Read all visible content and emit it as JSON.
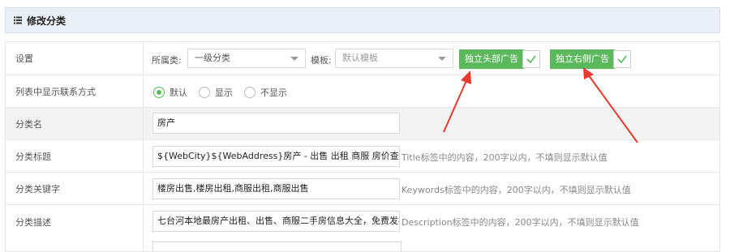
{
  "header": {
    "title": "修改分类",
    "icon": "list-icon"
  },
  "rows": {
    "settings": {
      "label": "设置",
      "category_label": "所属类:",
      "category_value": "一级分类",
      "template_label": "模板:",
      "template_value": "默认模板",
      "head_ad_label": "独立头部广告",
      "side_ad_label": "独立右侧广告"
    },
    "contact": {
      "label": "列表中显示联系方式",
      "options": [
        "默认",
        "显示",
        "不显示"
      ],
      "selected": "默认"
    },
    "name": {
      "label": "分类名",
      "value": "房产"
    },
    "title": {
      "label": "分类标题",
      "value": "${WebCity}${WebAddress}房产 - 出售 出租 商服 房价查询",
      "hint": "Title标签中的内容，200字以内，不填则显示默认值"
    },
    "keywords": {
      "label": "分类关键字",
      "value": "楼房出售,楼房出租,商服出租,商服出售",
      "hint": "Keywords标签中的内容，200字以内，不填则显示默认值"
    },
    "description": {
      "label": "分类描述",
      "value": "七台河本地最房产出租、出售、商服二手房信息大全，免费发布者",
      "hint": "Description标签中的内容，200字以内，不填则显示默认值"
    }
  },
  "colors": {
    "accent_green": "#5cb85c",
    "arrow_red": "#e8392e",
    "header_bg": "#e9f1f8"
  }
}
